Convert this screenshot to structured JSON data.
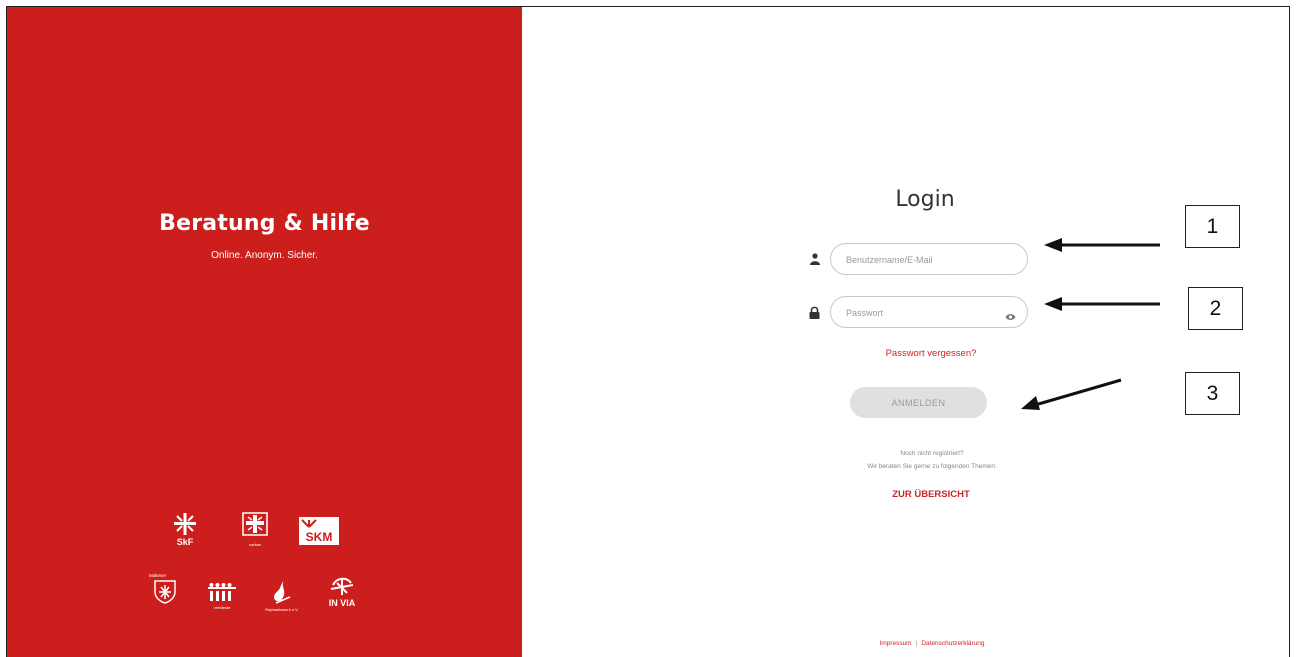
{
  "brand": {
    "title": "Beratung & Hilfe",
    "subtitle": "Online. Anonym. Sicher.",
    "background_color": "#cc1e1c"
  },
  "logos": [
    {
      "name": "SkF",
      "label": "SkF"
    },
    {
      "name": "Caritas",
      "label": "caritas"
    },
    {
      "name": "SKM",
      "label": "SKM"
    },
    {
      "name": "Malteser",
      "label": "Malteser"
    },
    {
      "name": "Verband",
      "label": "verbände"
    },
    {
      "name": "Raphaelswerk",
      "label": "Raphaelswerk e.V."
    },
    {
      "name": "IN VIA",
      "label": "IN VIA"
    }
  ],
  "login": {
    "title": "Login",
    "username_placeholder": "Benutzername/E-Mail",
    "password_placeholder": "Passwort",
    "forgot_password": "Passwort vergessen?",
    "submit_label": "ANMELDEN",
    "not_registered": "Noch nicht registriert?",
    "topics_hint": "Wir beraten Sie gerne zu folgenden Themen:",
    "overview_link": "ZUR ÜBERSICHT",
    "accent_color": "#c9262a"
  },
  "footer": {
    "imprint": "Impressum",
    "separator": "|",
    "privacy": "Datenschutzerklärung"
  },
  "annotations": [
    "1",
    "2",
    "3"
  ]
}
